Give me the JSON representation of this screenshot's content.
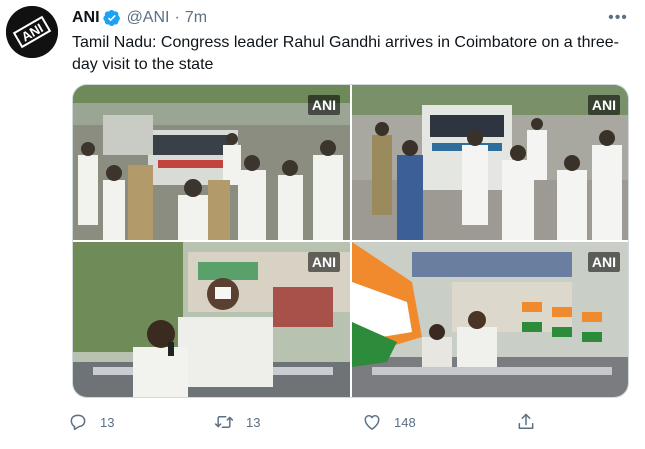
{
  "tweet": {
    "author": {
      "name": "ANI",
      "handle": "@ANI",
      "time": "7m",
      "separator": "·",
      "avatar_logo_text": "ANI"
    },
    "more_label": "•••",
    "text": "Tamil Nadu: Congress leader Rahul Gandhi arrives in Coimbatore on a three-day visit to the state",
    "media": {
      "watermark": "ANI",
      "photos": [
        {
          "scene": "crowd-walking-beside-convoy"
        },
        {
          "scene": "man-running-beside-vehicle"
        },
        {
          "scene": "leader-on-open-vehicle-with-speaker"
        },
        {
          "scene": "convoy-with-congress-flags"
        }
      ]
    },
    "actions": {
      "reply_count": "13",
      "retweet_count": "13",
      "like_count": "148"
    }
  },
  "colors": {
    "secondary_text": "#5b7083",
    "verified": "#1da1f2",
    "border": "#cfd9de"
  }
}
